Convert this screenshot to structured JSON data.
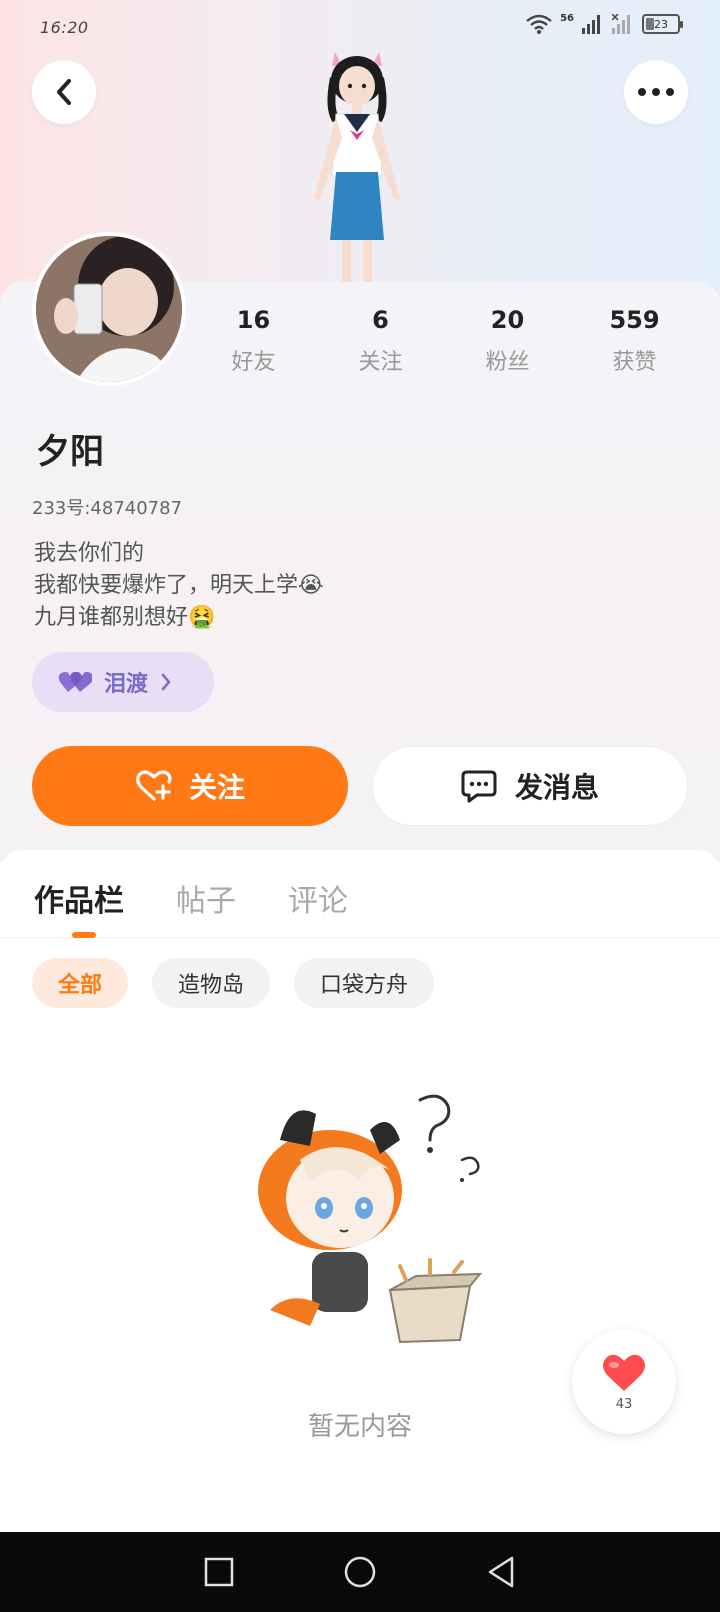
{
  "status_bar": {
    "time": "16:20",
    "network": "56",
    "battery": "23"
  },
  "header": {
    "back_icon": "chevron-left-icon",
    "more_icon": "ellipsis-icon"
  },
  "profile": {
    "stats": [
      {
        "value": "16",
        "label": "好友"
      },
      {
        "value": "6",
        "label": "关注"
      },
      {
        "value": "20",
        "label": "粉丝"
      },
      {
        "value": "559",
        "label": "获赞"
      }
    ],
    "username": "夕阳",
    "user_id": "233号:48740787",
    "bio": [
      "我去你们的",
      "我都快要爆炸了，明天上学😭",
      "九月谁都别想好🤮"
    ],
    "tag": {
      "label": "泪渡",
      "icon": "heart-icon"
    }
  },
  "actions": {
    "follow_label": "关注",
    "message_label": "发消息"
  },
  "tabs": [
    {
      "label": "作品栏"
    },
    {
      "label": "帖子"
    },
    {
      "label": "评论"
    }
  ],
  "filters": [
    {
      "label": "全部"
    },
    {
      "label": "造物岛"
    },
    {
      "label": "口袋方舟"
    }
  ],
  "empty_state": {
    "text": "暂无内容"
  },
  "like_fab": {
    "count": "43"
  },
  "colors": {
    "accent": "#ff7a14",
    "tag_bg": "#e6dff6",
    "tag_text": "#7a6cc4"
  }
}
